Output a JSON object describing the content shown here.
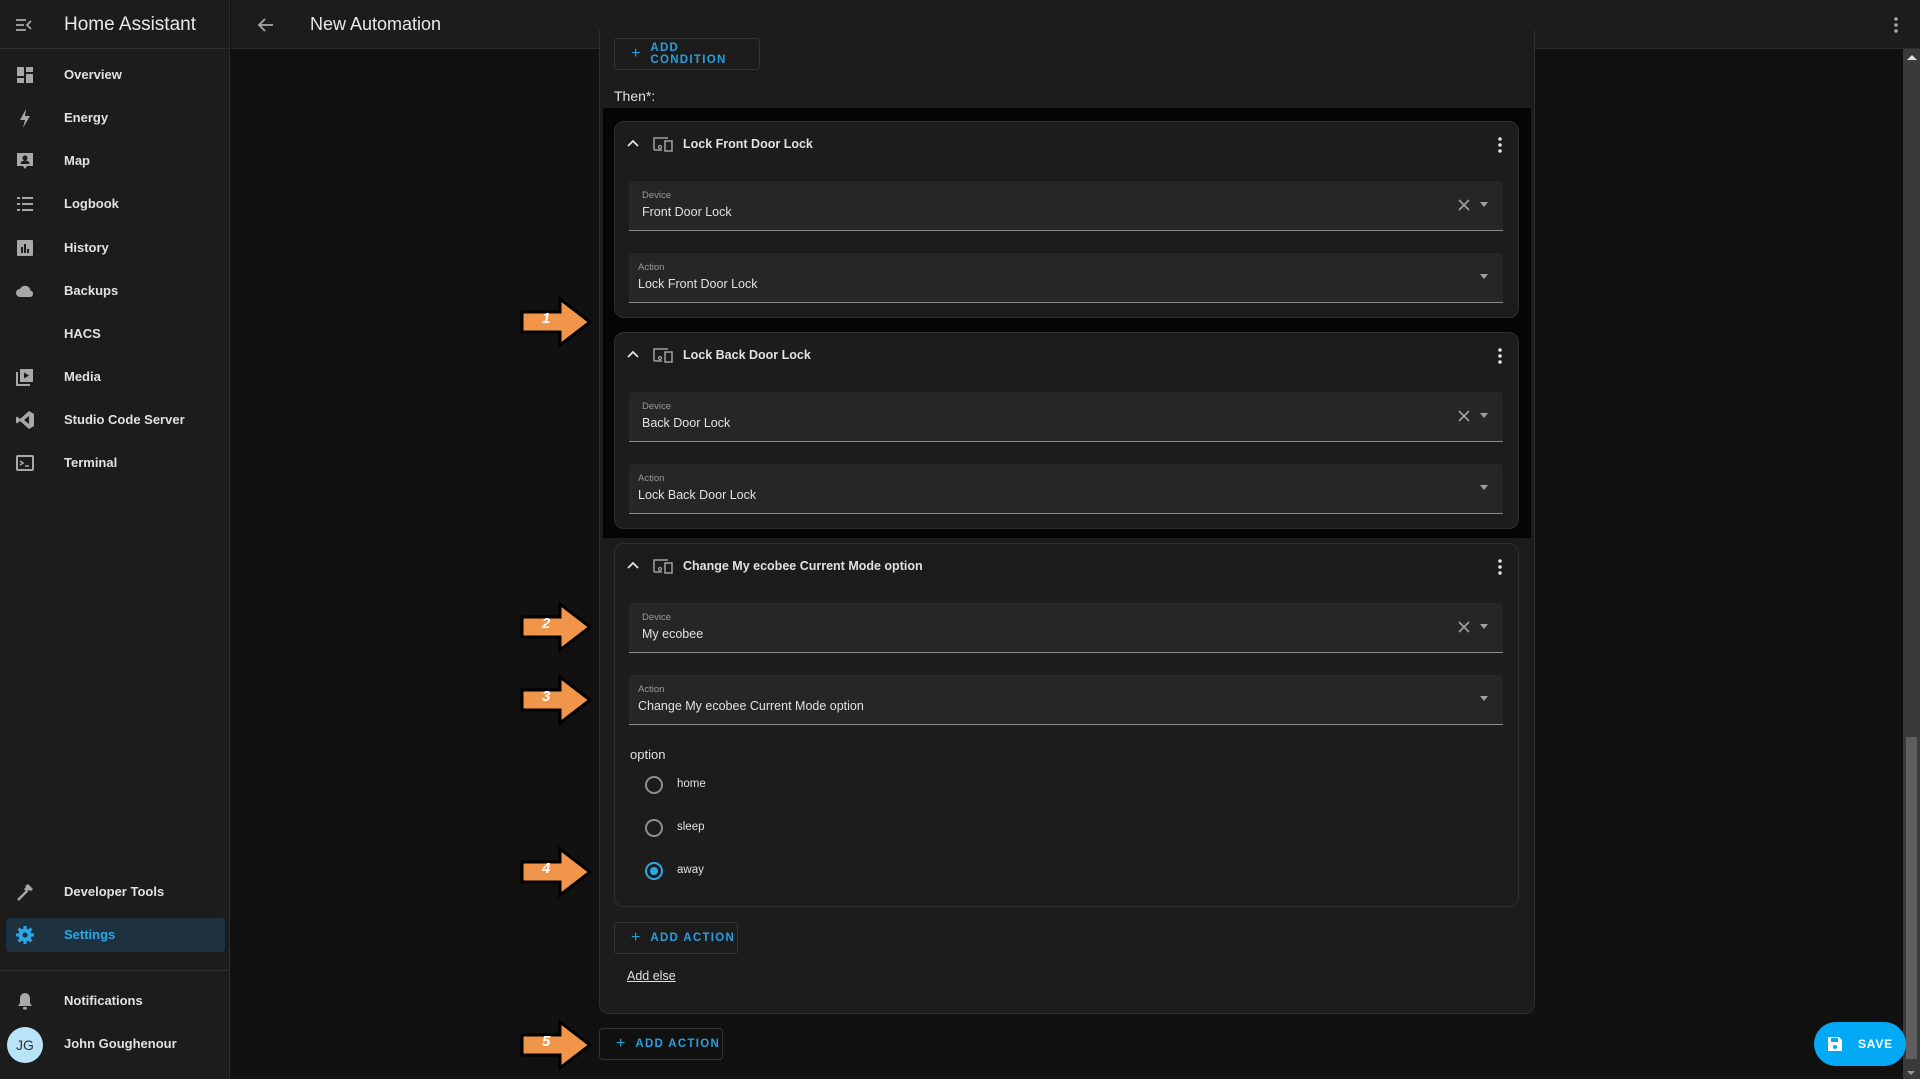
{
  "app": {
    "title": "Home Assistant"
  },
  "topbar": {
    "title": "New Automation"
  },
  "sidebar": {
    "items": [
      {
        "label": "Overview",
        "icon": "dashboard-icon"
      },
      {
        "label": "Energy",
        "icon": "lightning-icon"
      },
      {
        "label": "Map",
        "icon": "map-person-icon"
      },
      {
        "label": "Logbook",
        "icon": "list-icon"
      },
      {
        "label": "History",
        "icon": "chart-bar-icon"
      },
      {
        "label": "Backups",
        "icon": "cloud-icon"
      },
      {
        "label": "HACS",
        "icon": ""
      },
      {
        "label": "Media",
        "icon": "play-box-multiple-icon"
      },
      {
        "label": "Studio Code Server",
        "icon": "vscode-icon"
      },
      {
        "label": "Terminal",
        "icon": "console-icon"
      }
    ],
    "developer_tools": "Developer Tools",
    "settings": "Settings",
    "notifications": "Notifications",
    "user": {
      "name": "John Goughenour",
      "initials": "JG"
    }
  },
  "editor": {
    "add_condition": "ADD CONDITION",
    "then_label": "Then*:",
    "actions": [
      {
        "title": "Lock Front Door Lock",
        "device_label": "Device",
        "device_value": "Front Door Lock",
        "action_label": "Action",
        "action_value": "Lock Front Door Lock"
      },
      {
        "title": "Lock Back Door Lock",
        "device_label": "Device",
        "device_value": "Back Door Lock",
        "action_label": "Action",
        "action_value": "Lock Back Door Lock"
      },
      {
        "title": "Change My ecobee Current Mode option",
        "device_label": "Device",
        "device_value": "My ecobee",
        "action_label": "Action",
        "action_value": "Change My ecobee Current Mode option",
        "option_label": "option",
        "options": [
          "home",
          "sleep",
          "away"
        ],
        "selected_option": "away"
      }
    ],
    "add_action_inner": "ADD ACTION",
    "add_else": "Add else",
    "add_action_outer": "ADD ACTION"
  },
  "annotations": {
    "arrow_color": "#f0954a",
    "arrows": [
      "1",
      "2",
      "3",
      "4",
      "5"
    ]
  },
  "save_button": {
    "label": "SAVE",
    "color": "#03a9f4"
  }
}
